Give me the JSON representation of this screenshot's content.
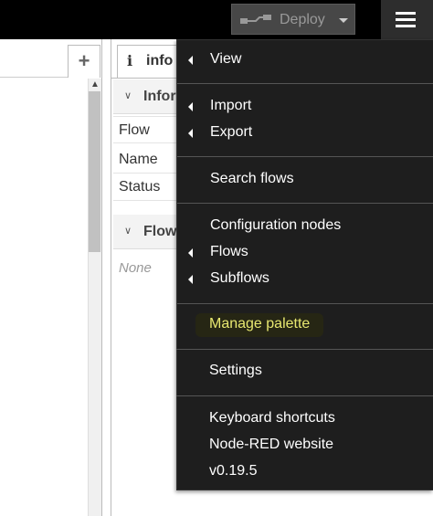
{
  "header": {
    "deploy_label": "Deploy",
    "colors": {
      "header_bg": "#000000",
      "deploy_bg": "#474747",
      "menu_btn_bg": "#2d2d2d"
    }
  },
  "workspace": {
    "add_tab_symbol": "+",
    "scroll_up_symbol": "▲"
  },
  "sidebar": {
    "info_tab": {
      "icon": "i",
      "label": "info"
    },
    "sections": [
      {
        "title": "Inform",
        "chevron": "∨"
      },
      {
        "title": "Flow",
        "chevron": "∨"
      }
    ],
    "properties": [
      "Flow",
      "Name",
      "Status"
    ],
    "flows_empty": "None"
  },
  "menu": {
    "items": [
      {
        "label": "View",
        "submenu": true
      },
      {
        "label": "Import",
        "submenu": true
      },
      {
        "label": "Export",
        "submenu": true
      },
      {
        "label": "Search flows",
        "submenu": false
      },
      {
        "label": "Configuration nodes",
        "submenu": false
      },
      {
        "label": "Flows",
        "submenu": true
      },
      {
        "label": "Subflows",
        "submenu": true
      },
      {
        "label": "Manage palette",
        "submenu": false,
        "highlighted": true
      },
      {
        "label": "Settings",
        "submenu": false
      },
      {
        "label": "Keyboard shortcuts",
        "submenu": false
      },
      {
        "label": "Node-RED website",
        "submenu": false
      },
      {
        "label": "v0.19.5",
        "submenu": false
      }
    ],
    "colors": {
      "bg": "#1e1e1e",
      "text": "#ffffff",
      "highlight_text": "#e8e870",
      "separator": "#555555"
    }
  }
}
